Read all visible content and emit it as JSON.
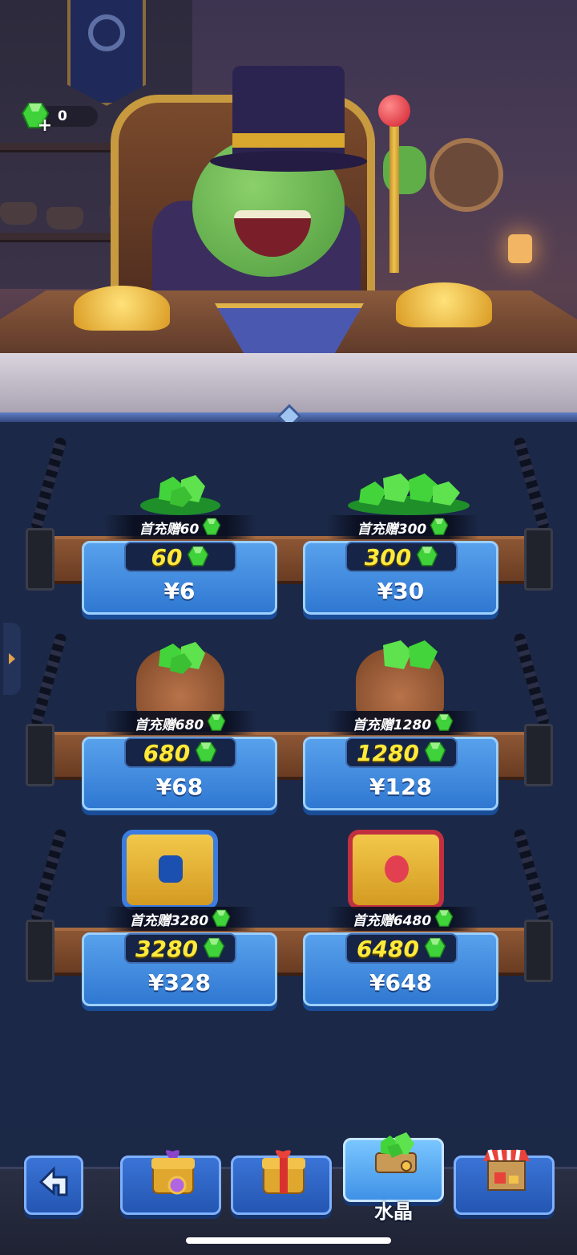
{
  "wallet": {
    "gem_count": "0"
  },
  "shelves": [
    {
      "items": [
        {
          "bonus_label": "首充赠60",
          "amount": "60",
          "price": "¥6",
          "art": "small-gem-pile"
        },
        {
          "bonus_label": "首充赠300",
          "amount": "300",
          "price": "¥30",
          "art": "large-gem-pile"
        }
      ]
    },
    {
      "items": [
        {
          "bonus_label": "首充赠680",
          "amount": "680",
          "price": "¥68",
          "art": "gem-sack"
        },
        {
          "bonus_label": "首充赠1280",
          "amount": "1280",
          "price": "¥128",
          "art": "gem-sack-large"
        }
      ]
    },
    {
      "items": [
        {
          "bonus_label": "首充赠3280",
          "amount": "3280",
          "price": "¥328",
          "art": "blue-gem-chest"
        },
        {
          "bonus_label": "首充赠6480",
          "amount": "6480",
          "price": "¥648",
          "art": "red-gem-chest"
        }
      ]
    }
  ],
  "bottom_nav": {
    "back_icon": "back-arrow-icon",
    "tabs": [
      {
        "icon": "purple-gift-chest-icon",
        "label": ""
      },
      {
        "icon": "red-gift-box-icon",
        "label": ""
      },
      {
        "icon": "crystal-cart-icon",
        "label": "水晶",
        "active": true
      },
      {
        "icon": "market-stall-icon",
        "label": ""
      }
    ]
  },
  "colors": {
    "gem": "#36c83a",
    "amount_text": "#ffea3a",
    "card_blue": "#3f88e0",
    "background": "#1b2846"
  }
}
